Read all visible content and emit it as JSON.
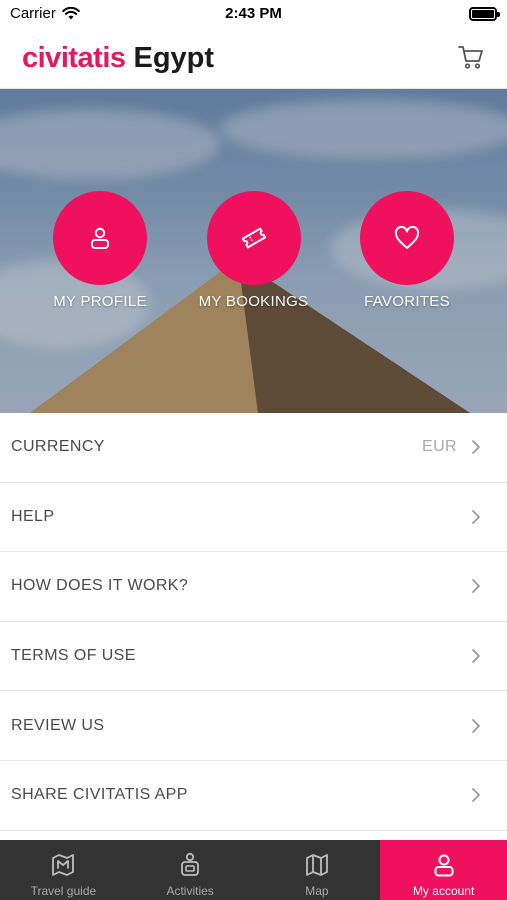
{
  "status_bar": {
    "carrier": "Carrier",
    "time": "2:43 PM"
  },
  "header": {
    "brand": "civitatis",
    "country": "Egypt",
    "cart_icon": "cart-icon"
  },
  "hero": {
    "actions": [
      {
        "label": "MY PROFILE",
        "icon": "user-icon"
      },
      {
        "label": "MY BOOKINGS",
        "icon": "ticket-icon"
      },
      {
        "label": "FAVORITES",
        "icon": "heart-icon"
      }
    ]
  },
  "menu": {
    "items": [
      {
        "label": "CURRENCY",
        "value": "EUR"
      },
      {
        "label": "HELP",
        "value": ""
      },
      {
        "label": "HOW DOES IT WORK?",
        "value": ""
      },
      {
        "label": "TERMS OF USE",
        "value": ""
      },
      {
        "label": "REVIEW US",
        "value": ""
      },
      {
        "label": "SHARE CIVITATIS APP",
        "value": ""
      }
    ]
  },
  "tab_bar": {
    "tabs": [
      {
        "label": "Travel guide",
        "icon": "guide-map-icon",
        "active": false
      },
      {
        "label": "Activities",
        "icon": "activities-icon",
        "active": false
      },
      {
        "label": "Map",
        "icon": "map-icon",
        "active": false
      },
      {
        "label": "My account",
        "icon": "user-icon",
        "active": true
      }
    ]
  },
  "colors": {
    "brand": "#e4185f",
    "accent": "#f0115e",
    "tab_bar": "#333333"
  }
}
